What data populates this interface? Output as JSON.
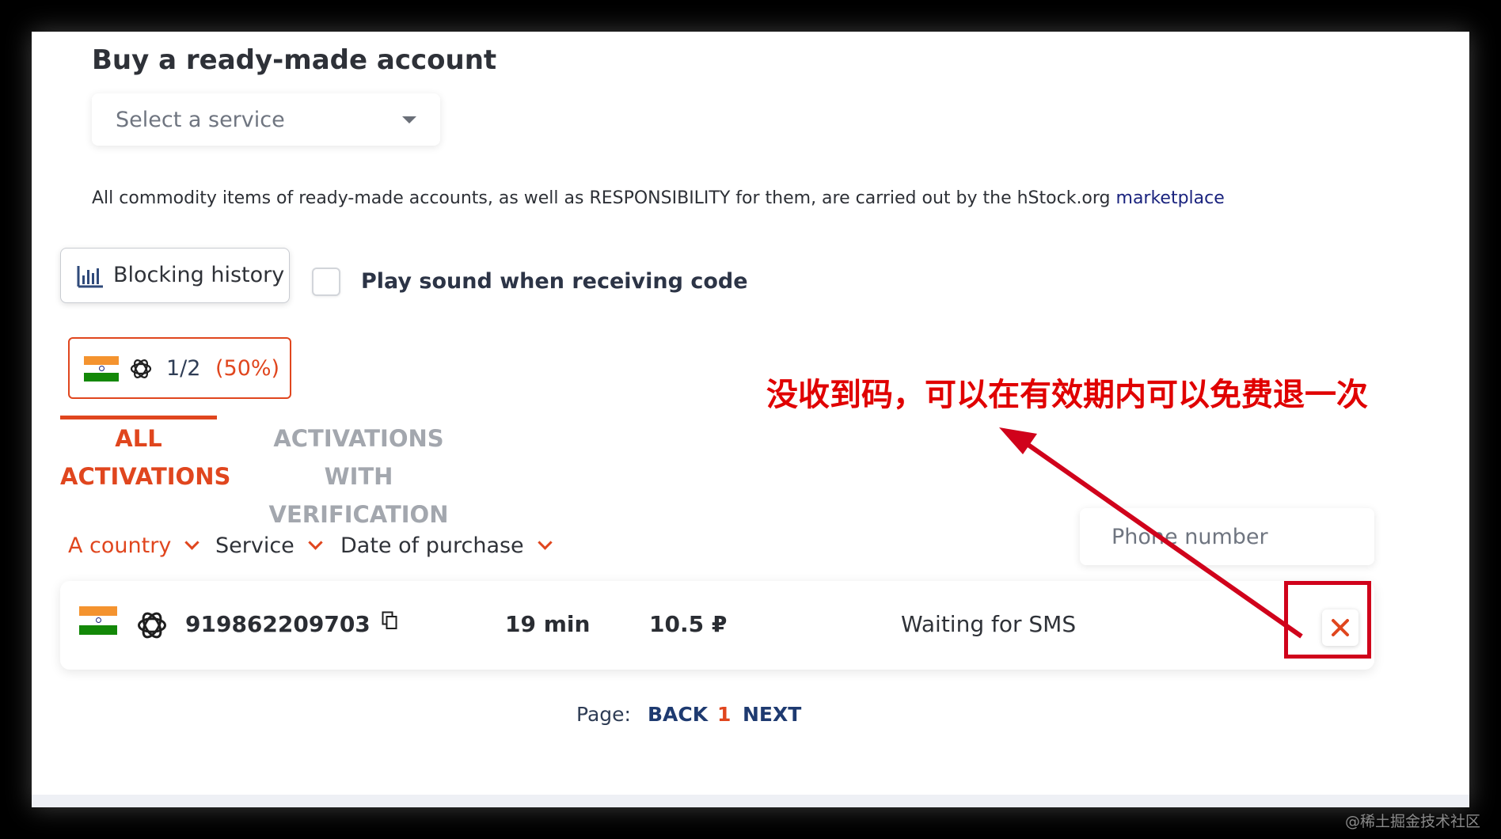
{
  "page": {
    "title": "Buy a ready-made account",
    "service_select": {
      "placeholder": "Select a service"
    },
    "notice": {
      "text": "All commodity items of ready-made accounts, as well as RESPONSIBILITY for them, are carried out by the hStock.org ",
      "link": "marketplace"
    },
    "blocking_history_label": "Blocking history",
    "play_sound_label": "Play sound when receiving code",
    "play_sound_checked": false
  },
  "stats": {
    "ratio": "1/2",
    "percent": "(50%)"
  },
  "tabs": {
    "all_line1": "ALL",
    "all_line2": "ACTIVATIONS",
    "ver_line1": "ACTIVATIONS",
    "ver_line2": "WITH VERIFICATION",
    "active": "ALL ACTIVATIONS"
  },
  "filters": {
    "country": "A country",
    "service": "Service",
    "date": "Date of purchase",
    "phone_placeholder": "Phone number"
  },
  "activations": [
    {
      "country_flag": "india-flag",
      "service_icon": "openai-icon",
      "phone": "919862209703",
      "duration": "19 min",
      "price": "10.5 ₽",
      "status": "Waiting for SMS"
    }
  ],
  "pagination": {
    "label": "Page:",
    "back": "BACK",
    "current": "1",
    "next": "NEXT"
  },
  "annotation": {
    "text": "没收到码，可以在有效期内可以免费退一次"
  },
  "watermark": "@稀土掘金技术社区",
  "colors": {
    "accent": "#e0461e",
    "link": "#1a237e",
    "annotation": "#e00000"
  }
}
